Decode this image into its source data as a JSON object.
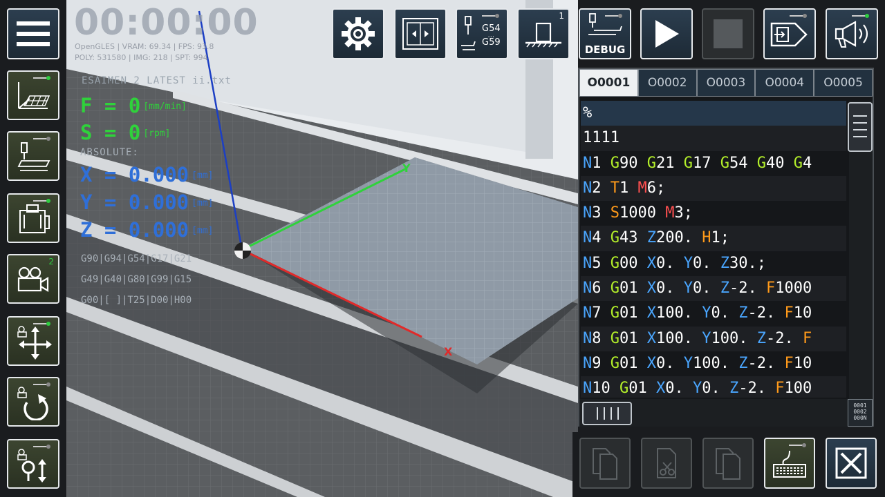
{
  "timer": "00:00:00",
  "stats": {
    "line1": "OpenGLES | VRAM: 69.34 | FPS: 93.8",
    "line2": "POLY: 531580 | IMG: 218 | SPT: 994"
  },
  "overlay": {
    "file_name": "ESAIMEN 2 LATEST ii.txt",
    "feed": "F = 0",
    "feed_unit": "[mm/min]",
    "speed": "S = 0",
    "speed_unit": "[rpm]",
    "mode": "ABSOLUTE:",
    "x": "X = 0.000",
    "y": "Y = 0.000",
    "z": "Z = 0.000",
    "pos_unit": "[mm]",
    "modal1": "G90|G94|G54|G17|G21",
    "modal2": "G49|G40|G80|G99|G15",
    "modal3": "G00|[ ]|T25|D00|H00"
  },
  "axes": {
    "x": "X",
    "y": "Y"
  },
  "toolbar": {
    "g54": "G54",
    "dots": "...",
    "g59": "G59",
    "home_badge": "1",
    "debug": "DEBUG"
  },
  "sidebar": {
    "camera_badge": "2"
  },
  "tabs": [
    "O0001",
    "O0002",
    "O0003",
    "O0004",
    "O0005"
  ],
  "code_lines": [
    [
      {
        "t": "%",
        "c": ""
      }
    ],
    [
      {
        "t": "1111",
        "c": ""
      }
    ],
    [
      {
        "t": "N",
        "c": "n"
      },
      {
        "t": "1 ",
        "c": ""
      },
      {
        "t": "G",
        "c": "g"
      },
      {
        "t": "90 ",
        "c": ""
      },
      {
        "t": "G",
        "c": "g"
      },
      {
        "t": "21 ",
        "c": ""
      },
      {
        "t": "G",
        "c": "g"
      },
      {
        "t": "17 ",
        "c": ""
      },
      {
        "t": "G",
        "c": "g"
      },
      {
        "t": "54 ",
        "c": ""
      },
      {
        "t": "G",
        "c": "g"
      },
      {
        "t": "40 ",
        "c": ""
      },
      {
        "t": "G",
        "c": "g"
      },
      {
        "t": "4",
        "c": ""
      }
    ],
    [
      {
        "t": "N",
        "c": "n"
      },
      {
        "t": "2 ",
        "c": ""
      },
      {
        "t": "T",
        "c": "t"
      },
      {
        "t": "1 ",
        "c": ""
      },
      {
        "t": "M",
        "c": "m"
      },
      {
        "t": "6;",
        "c": ""
      }
    ],
    [
      {
        "t": "N",
        "c": "n"
      },
      {
        "t": "3 ",
        "c": ""
      },
      {
        "t": "S",
        "c": "f"
      },
      {
        "t": "1000 ",
        "c": ""
      },
      {
        "t": "M",
        "c": "m"
      },
      {
        "t": "3;",
        "c": ""
      }
    ],
    [
      {
        "t": "N",
        "c": "n"
      },
      {
        "t": "4 ",
        "c": ""
      },
      {
        "t": "G",
        "c": "g"
      },
      {
        "t": "43 ",
        "c": ""
      },
      {
        "t": "Z",
        "c": "xyz"
      },
      {
        "t": "200. ",
        "c": ""
      },
      {
        "t": "H",
        "c": "f"
      },
      {
        "t": "1;",
        "c": ""
      }
    ],
    [
      {
        "t": "N",
        "c": "n"
      },
      {
        "t": "5 ",
        "c": ""
      },
      {
        "t": "G",
        "c": "g"
      },
      {
        "t": "00 ",
        "c": ""
      },
      {
        "t": "X",
        "c": "xyz"
      },
      {
        "t": "0. ",
        "c": ""
      },
      {
        "t": "Y",
        "c": "xyz"
      },
      {
        "t": "0. ",
        "c": ""
      },
      {
        "t": "Z",
        "c": "xyz"
      },
      {
        "t": "30.;",
        "c": ""
      }
    ],
    [
      {
        "t": "N",
        "c": "n"
      },
      {
        "t": "6 ",
        "c": ""
      },
      {
        "t": "G",
        "c": "g"
      },
      {
        "t": "01 ",
        "c": ""
      },
      {
        "t": "X",
        "c": "xyz"
      },
      {
        "t": "0. ",
        "c": ""
      },
      {
        "t": "Y",
        "c": "xyz"
      },
      {
        "t": "0. ",
        "c": ""
      },
      {
        "t": "Z",
        "c": "xyz"
      },
      {
        "t": "-2. ",
        "c": ""
      },
      {
        "t": "F",
        "c": "f"
      },
      {
        "t": "1000",
        "c": ""
      }
    ],
    [
      {
        "t": "N",
        "c": "n"
      },
      {
        "t": "7 ",
        "c": ""
      },
      {
        "t": "G",
        "c": "g"
      },
      {
        "t": "01 ",
        "c": ""
      },
      {
        "t": "X",
        "c": "xyz"
      },
      {
        "t": "100. ",
        "c": ""
      },
      {
        "t": "Y",
        "c": "xyz"
      },
      {
        "t": "0. ",
        "c": ""
      },
      {
        "t": "Z",
        "c": "xyz"
      },
      {
        "t": "-2. ",
        "c": ""
      },
      {
        "t": "F",
        "c": "f"
      },
      {
        "t": "10",
        "c": ""
      }
    ],
    [
      {
        "t": "N",
        "c": "n"
      },
      {
        "t": "8 ",
        "c": ""
      },
      {
        "t": "G",
        "c": "g"
      },
      {
        "t": "01 ",
        "c": ""
      },
      {
        "t": "X",
        "c": "xyz"
      },
      {
        "t": "100. ",
        "c": ""
      },
      {
        "t": "Y",
        "c": "xyz"
      },
      {
        "t": "100. ",
        "c": ""
      },
      {
        "t": "Z",
        "c": "xyz"
      },
      {
        "t": "-2. ",
        "c": ""
      },
      {
        "t": "F",
        "c": "f"
      }
    ],
    [
      {
        "t": "N",
        "c": "n"
      },
      {
        "t": "9 ",
        "c": ""
      },
      {
        "t": "G",
        "c": "g"
      },
      {
        "t": "01 ",
        "c": ""
      },
      {
        "t": "X",
        "c": "xyz"
      },
      {
        "t": "0. ",
        "c": ""
      },
      {
        "t": "Y",
        "c": "xyz"
      },
      {
        "t": "100. ",
        "c": ""
      },
      {
        "t": "Z",
        "c": "xyz"
      },
      {
        "t": "-2. ",
        "c": ""
      },
      {
        "t": "F",
        "c": "f"
      },
      {
        "t": "10",
        "c": ""
      }
    ],
    [
      {
        "t": "N",
        "c": "n"
      },
      {
        "t": "10 ",
        "c": ""
      },
      {
        "t": "G",
        "c": "g"
      },
      {
        "t": "01 ",
        "c": ""
      },
      {
        "t": "X",
        "c": "xyz"
      },
      {
        "t": "0. ",
        "c": ""
      },
      {
        "t": "Y",
        "c": "xyz"
      },
      {
        "t": "0. ",
        "c": ""
      },
      {
        "t": "Z",
        "c": "xyz"
      },
      {
        "t": "-2. ",
        "c": ""
      },
      {
        "t": "F",
        "c": "f"
      },
      {
        "t": "100",
        "c": ""
      }
    ]
  ],
  "numbering_icon": [
    "0001",
    "0002",
    "000N"
  ],
  "colors": {
    "accent_green": "#2fd23b",
    "accent_blue": "#2f6fd8",
    "button_bg": "#1d2a36",
    "led_green": "#2ecc40"
  }
}
